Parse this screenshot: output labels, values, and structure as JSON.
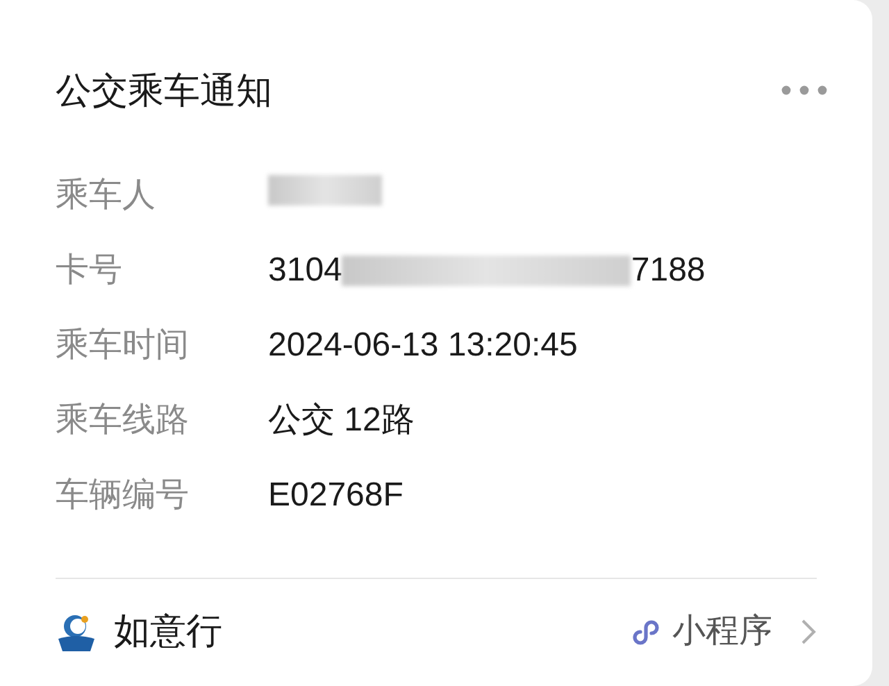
{
  "title": "公交乘车通知",
  "fields": [
    {
      "label": "乘车人",
      "kind": "redacted"
    },
    {
      "label": "卡号",
      "kind": "masked",
      "start": "3104",
      "end": "7188"
    },
    {
      "label": "乘车时间",
      "kind": "text",
      "value": "2024-06-13 13:20:45"
    },
    {
      "label": "乘车线路",
      "kind": "text",
      "value": "公交 12路"
    },
    {
      "label": "车辆编号",
      "kind": "text",
      "value": "E02768F"
    }
  ],
  "footer": {
    "app_name": "如意行",
    "link": "小程序"
  }
}
